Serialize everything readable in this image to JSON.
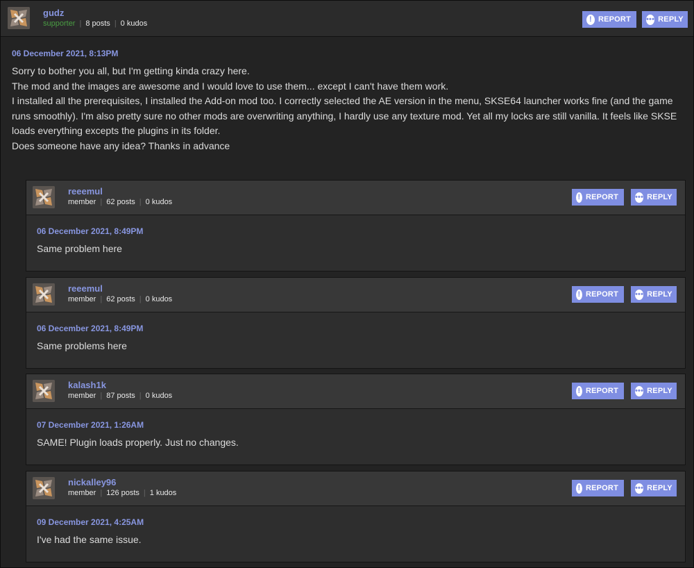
{
  "buttons": {
    "report": "REPORT",
    "reply": "REPLY"
  },
  "main_post": {
    "username": "gudz",
    "role": "supporter",
    "posts": "8 posts",
    "kudos": "0 kudos",
    "date": "06 December 2021, 8:13PM",
    "lines": [
      "Sorry to bother you all, but I'm getting kinda crazy here.",
      "The mod and the images are awesome and I would love to use them... except I can't have them work.",
      "I installed all the prerequisites, I installed the Add-on mod too. I correctly selected the AE version in the menu, SKSE64 launcher works fine (and the game runs smoothly). I'm also pretty sure no other mods are overwriting anything, I hardly use any texture mod. Yet all my locks are still vanilla. It feels like SKSE loads everything excepts the plugins in its folder.",
      "Does someone have any idea? Thanks in advance"
    ]
  },
  "replies": [
    {
      "username": "reeemul",
      "role": "member",
      "posts": "62 posts",
      "kudos": "0 kudos",
      "date": "06 December 2021, 8:49PM",
      "text": "Same problem here"
    },
    {
      "username": "reeemul",
      "role": "member",
      "posts": "62 posts",
      "kudos": "0 kudos",
      "date": "06 December 2021, 8:49PM",
      "text": "Same problems here"
    },
    {
      "username": "kalash1k",
      "role": "member",
      "posts": "87 posts",
      "kudos": "0 kudos",
      "date": "07 December 2021, 1:26AM",
      "text": "SAME! Plugin loads properly. Just no changes."
    },
    {
      "username": "nickalley96",
      "role": "member",
      "posts": "126 posts",
      "kudos": "1 kudos",
      "date": "09 December 2021, 4:25AM",
      "text": "I've had the same issue."
    }
  ],
  "colors": {
    "accent": "#7f8ee2",
    "username": "#8896e0",
    "supporter": "#4a9d43"
  }
}
